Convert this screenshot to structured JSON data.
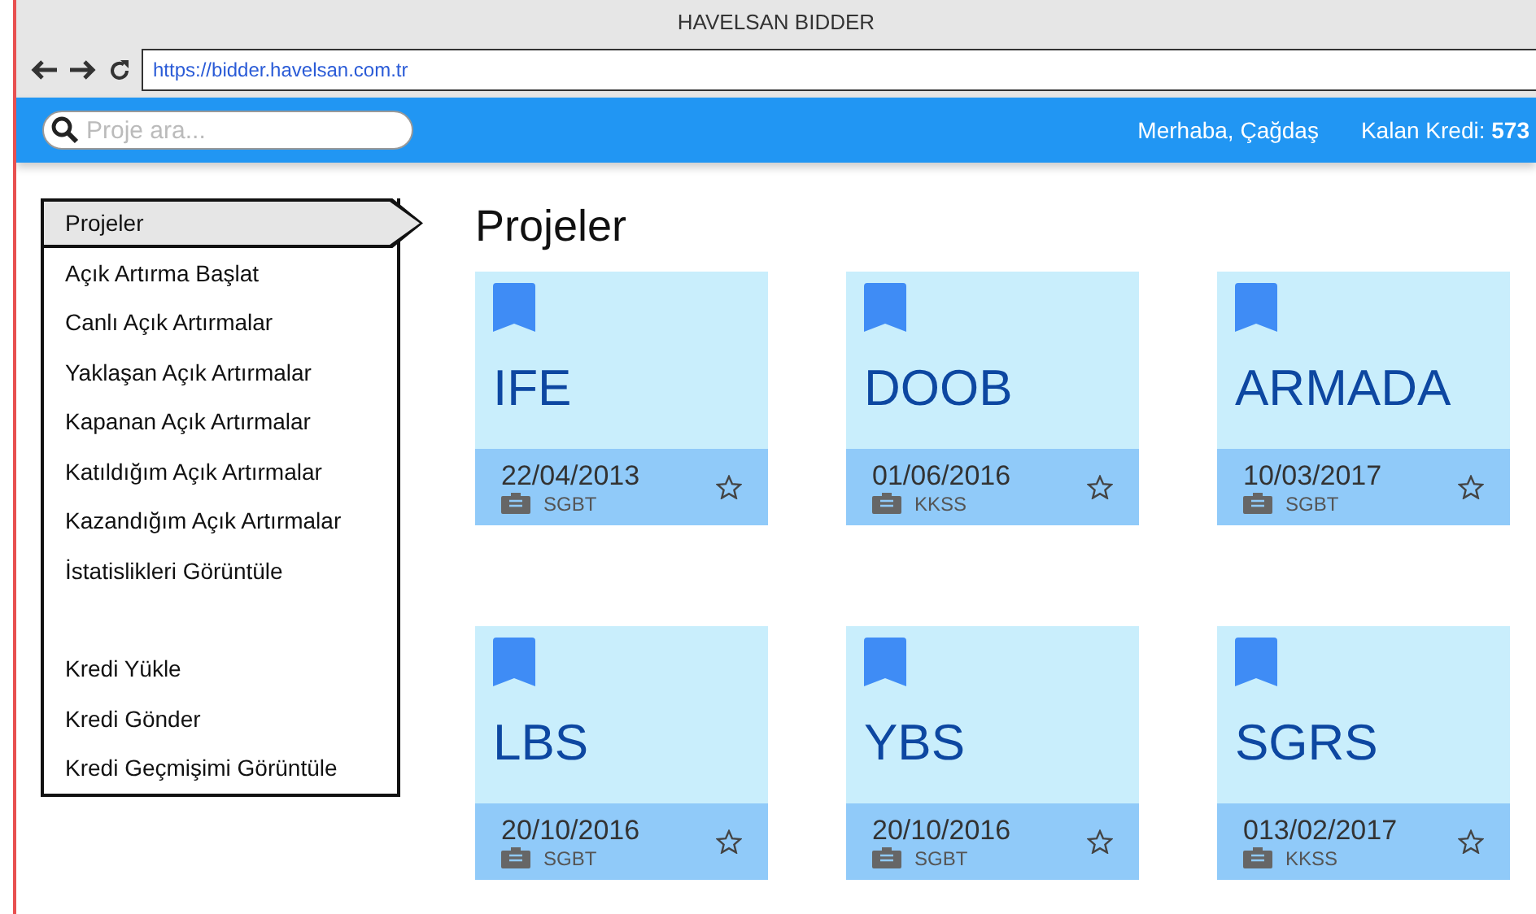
{
  "window": {
    "title": "HAVELSAN BIDDER"
  },
  "browser": {
    "url": "https://bidder.havelsan.com.tr"
  },
  "header": {
    "search": {
      "placeholder": "Proje ara..."
    },
    "greeting": "Merhaba, Çağdaş",
    "credit_label": "Kalan Kredi:",
    "credit_value": "573"
  },
  "sidebar": {
    "sections": [
      [
        {
          "label": "Projeler",
          "selected": true
        },
        {
          "label": "Açık Artırma Başlat",
          "selected": false
        },
        {
          "label": "Canlı Açık Artırmalar",
          "selected": false
        },
        {
          "label": "Yaklaşan Açık Artırmalar",
          "selected": false
        },
        {
          "label": "Kapanan Açık Artırmalar",
          "selected": false
        },
        {
          "label": "Katıldığım Açık Artırmalar",
          "selected": false
        },
        {
          "label": "Kazandığım Açık Artırmalar",
          "selected": false
        },
        {
          "label": "İstatislikleri Görüntüle",
          "selected": false
        }
      ],
      [
        {
          "label": "Kredi Yükle",
          "selected": false
        },
        {
          "label": "Kredi Gönder",
          "selected": false
        },
        {
          "label": "Kredi Geçmişimi Görüntüle",
          "selected": false
        }
      ]
    ]
  },
  "main": {
    "heading": "Projeler",
    "projects": [
      {
        "name": "IFE",
        "date": "22/04/2013",
        "unit": "SGBT"
      },
      {
        "name": "DOOB",
        "date": "01/06/2016",
        "unit": "KKSS"
      },
      {
        "name": "ARMADA",
        "date": "10/03/2017",
        "unit": "SGBT"
      },
      {
        "name": "LBS",
        "date": "20/10/2016",
        "unit": "SGBT"
      },
      {
        "name": "YBS",
        "date": "20/10/2016",
        "unit": "SGBT"
      },
      {
        "name": "SGRS",
        "date": "013/02/2017",
        "unit": "KKSS"
      }
    ]
  }
}
